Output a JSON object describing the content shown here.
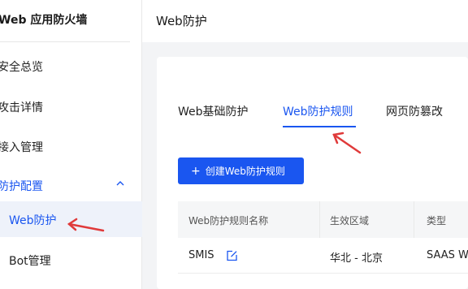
{
  "sidebar": {
    "brand": "Web 应用防火墙",
    "items": [
      {
        "label": "安全总览"
      },
      {
        "label": "攻击详情"
      },
      {
        "label": "接入管理"
      }
    ],
    "group": {
      "label": "防护配置",
      "expanded": true,
      "children": [
        {
          "label": "Web防护",
          "active": true
        },
        {
          "label": "Bot管理"
        }
      ]
    }
  },
  "header": {
    "title": "Web防护"
  },
  "tabs": [
    {
      "label": "Web基础防护"
    },
    {
      "label": "Web防护规则",
      "active": true
    },
    {
      "label": "网页防篡改"
    }
  ],
  "create_button": {
    "icon": "plus-icon",
    "label": "创建Web防护规则"
  },
  "table": {
    "columns": [
      "Web防护规则名称",
      "生效区域",
      "类型"
    ],
    "rows": [
      {
        "name": "SMIS",
        "region": "华北 - 北京",
        "type": "SAAS W"
      }
    ]
  },
  "colors": {
    "accent": "#1a56f0",
    "annotation": "#e03a3a"
  }
}
